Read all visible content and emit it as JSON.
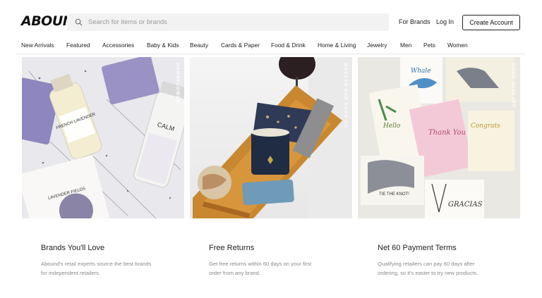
{
  "header": {
    "logo": "ABOUND",
    "search_placeholder": "Search for items or brands",
    "for_brands": "For Brands",
    "log_in": "Log In",
    "create_account": "Create Account"
  },
  "categories": [
    "New Arrivals",
    "Featured",
    "Accessories",
    "Baby & Kids",
    "Beauty",
    "Cards & Paper",
    "Food & Drink",
    "Home & Living",
    "Jewelry",
    "Men",
    "Pets",
    "Women"
  ],
  "tiles": [
    {
      "brand_label": "HORNBLOWER",
      "texts": [
        "FRENCH LAVENDER",
        "CALM",
        "LAVENDER FIELDS"
      ]
    },
    {
      "brand_label": "MAKESA BAR SOAP CO",
      "texts": []
    },
    {
      "brand_label": "GOOD JUJU INK",
      "texts": [
        "Whale",
        "Hello",
        "Thank You",
        "Congrats",
        "TIE THE KNOT!",
        "GRACIAS"
      ]
    }
  ],
  "features": [
    {
      "title": "Brands You'll Love",
      "line1": "Abound's retail experts source the best brands",
      "line2": "for independent retailers."
    },
    {
      "title": "Free Returns",
      "line1": "Get free returns within 60 days on your first",
      "line2": "order from any brand."
    },
    {
      "title": "Net 60 Payment Terms",
      "line1": "Qualifying retailers can pay 60 days after",
      "line2": "ordering, so it's easier to try new products."
    }
  ]
}
